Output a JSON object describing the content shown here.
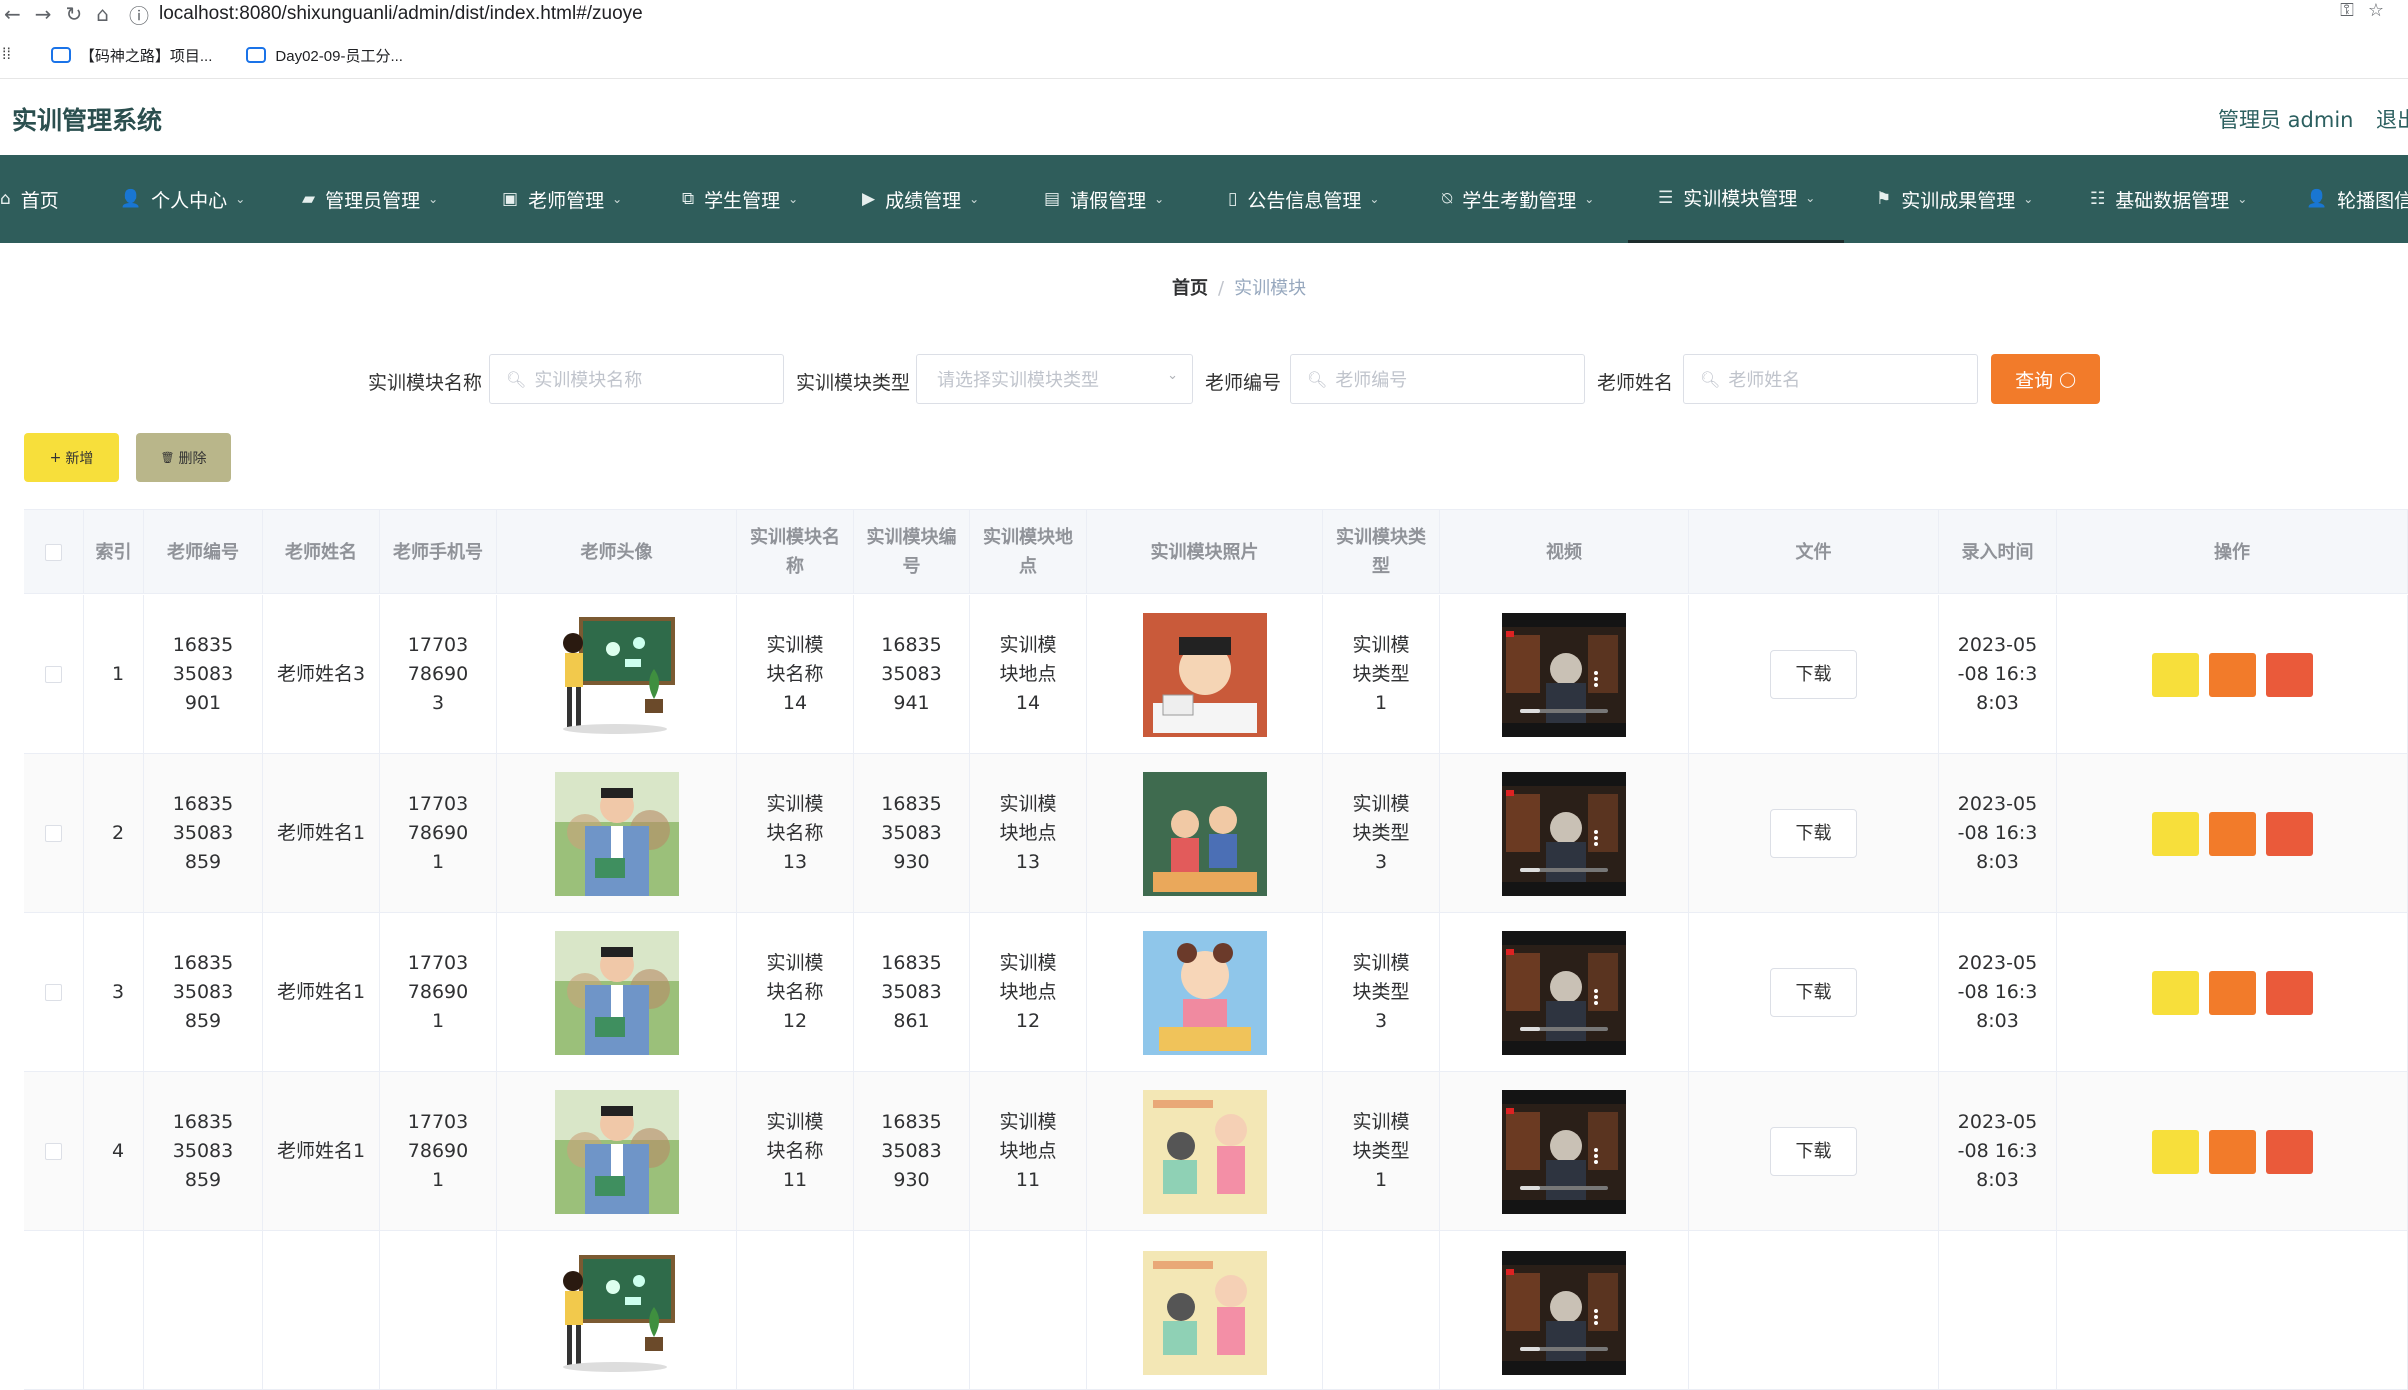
{
  "browser": {
    "url": "localhost:8080/shixunguanli/admin/dist/index.html#/zuoye",
    "bookmarks": [
      "【码神之路】项目...",
      "Day02-09-员工分..."
    ]
  },
  "header": {
    "system_title": "实训管理系统",
    "user_label": "管理员 admin",
    "logout_label": "退出"
  },
  "nav": {
    "items": [
      {
        "label": "首页",
        "icon": "home-icon",
        "has_dropdown": false
      },
      {
        "label": "个人中心",
        "icon": "user-icon",
        "has_dropdown": true
      },
      {
        "label": "管理员管理",
        "icon": "briefcase-icon",
        "has_dropdown": true
      },
      {
        "label": "老师管理",
        "icon": "trash-icon",
        "has_dropdown": true
      },
      {
        "label": "学生管理",
        "icon": "copy-icon",
        "has_dropdown": true
      },
      {
        "label": "成绩管理",
        "icon": "camera-icon",
        "has_dropdown": true
      },
      {
        "label": "请假管理",
        "icon": "box-icon",
        "has_dropdown": true
      },
      {
        "label": "公告信息管理",
        "icon": "mic-icon",
        "has_dropdown": true
      },
      {
        "label": "学生考勤管理",
        "icon": "bell-off-icon",
        "has_dropdown": true
      },
      {
        "label": "实训模块管理",
        "icon": "menu-icon",
        "has_dropdown": true
      },
      {
        "label": "实训成果管理",
        "icon": "flag-icon",
        "has_dropdown": true
      },
      {
        "label": "基础数据管理",
        "icon": "sliders-icon",
        "has_dropdown": true
      },
      {
        "label": "轮播图信",
        "icon": "user-icon",
        "has_dropdown": false
      }
    ]
  },
  "breadcrumb": {
    "home": "首页",
    "separator": "/",
    "current": "实训模块"
  },
  "search": {
    "fields": [
      {
        "label": "实训模块名称",
        "placeholder": "实训模块名称"
      },
      {
        "label": "实训模块类型",
        "placeholder": "请选择实训模块类型"
      },
      {
        "label": "老师编号",
        "placeholder": "老师编号"
      },
      {
        "label": "老师姓名",
        "placeholder": "老师姓名"
      }
    ],
    "query_label": "查询"
  },
  "actions": {
    "add_label": "新增",
    "delete_label": "删除"
  },
  "table": {
    "columns": [
      "",
      "索引",
      "老师编号",
      "老师姓名",
      "老师手机号",
      "老师头像",
      "实训模块名称",
      "实训模块编号",
      "实训模块地点",
      "实训模块照片",
      "实训模块类型",
      "视频",
      "文件",
      "录入时间",
      "操作"
    ],
    "download_label": "下载",
    "rows": [
      {
        "index": "1",
        "teacher_no": "1683535083901",
        "teacher_name": "老师姓名3",
        "phone": "17703786903",
        "module_name": "实训模块名称14",
        "module_no": "1683535083941",
        "location": "实训模块地点14",
        "module_type": "实训模块类型1",
        "time": "2023-05-08 16:38:03"
      },
      {
        "index": "2",
        "teacher_no": "1683535083859",
        "teacher_name": "老师姓名1",
        "phone": "17703786901",
        "module_name": "实训模块名称13",
        "module_no": "1683535083930",
        "location": "实训模块地点13",
        "module_type": "实训模块类型3",
        "time": "2023-05-08 16:38:03"
      },
      {
        "index": "3",
        "teacher_no": "1683535083859",
        "teacher_name": "老师姓名1",
        "phone": "17703786901",
        "module_name": "实训模块名称12",
        "module_no": "1683535083861",
        "location": "实训模块地点12",
        "module_type": "实训模块类型3",
        "time": "2023-05-08 16:38:03"
      },
      {
        "index": "4",
        "teacher_no": "1683535083859",
        "teacher_name": "老师姓名1",
        "phone": "17703786901",
        "module_name": "实训模块名称11",
        "module_no": "1683535083930",
        "location": "实训模块地点11",
        "module_type": "实训模块类型1",
        "time": "2023-05-08 16:38:03"
      }
    ]
  },
  "colors": {
    "nav_bg": "#2f5d5b",
    "query": "#f27b2a",
    "add": "#f7df3b",
    "delete": "#b9b68a",
    "op_yellow": "#f7df3b",
    "op_orange": "#f27b2a",
    "op_red": "#ea5a3a"
  }
}
